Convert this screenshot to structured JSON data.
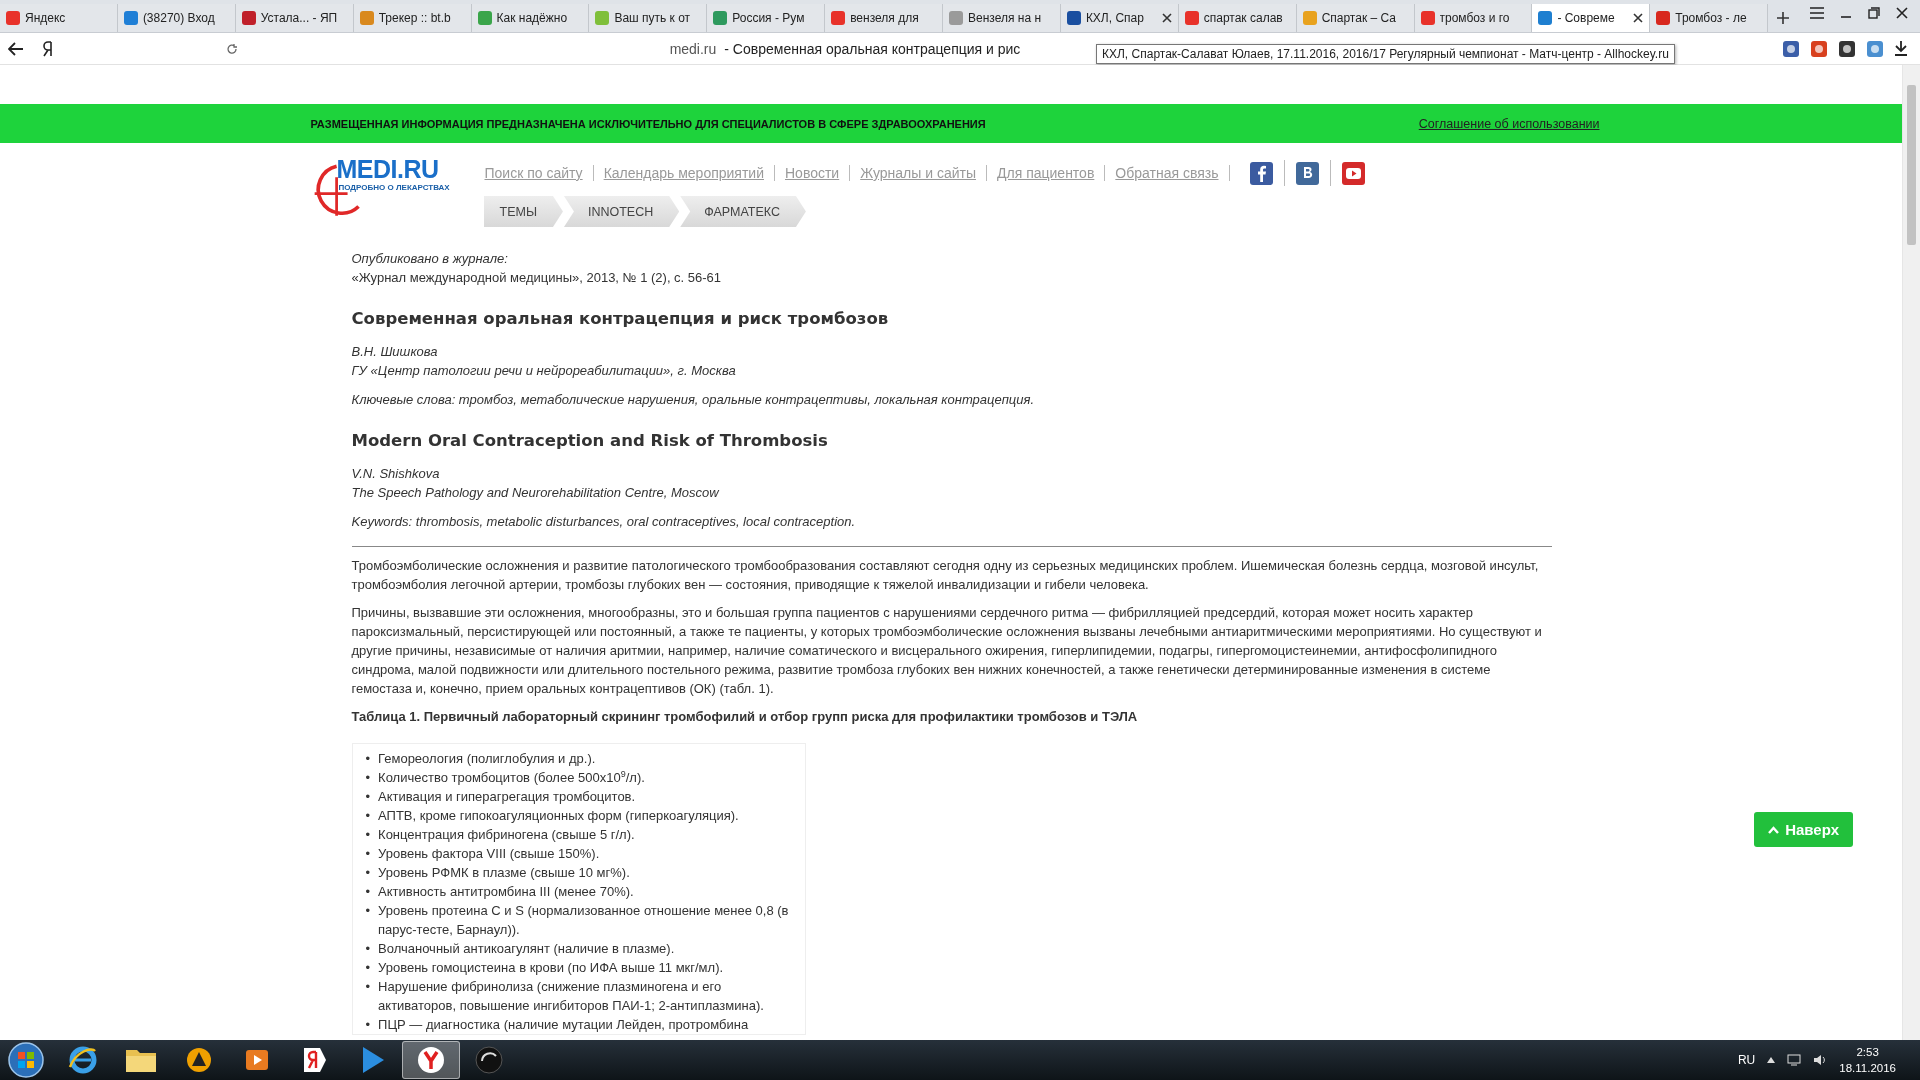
{
  "browser": {
    "tabs": [
      {
        "title": "Яндекс",
        "color": "#e8322a",
        "selected": false,
        "closable": false
      },
      {
        "title": "(38270) Вход",
        "color": "#1f7fd6",
        "selected": false,
        "closable": false
      },
      {
        "title": "Устала... - ЯП",
        "color": "#c0202a",
        "selected": false,
        "closable": false
      },
      {
        "title": "Трекер :: bt.b",
        "color": "#d9891e",
        "selected": false,
        "closable": false
      },
      {
        "title": "Как надёжно",
        "color": "#3aa54a",
        "selected": false,
        "closable": false
      },
      {
        "title": "Ваш путь к от",
        "color": "#7fbf3a",
        "selected": false,
        "closable": false
      },
      {
        "title": "Россия - Рум",
        "color": "#2e9a5e",
        "selected": false,
        "closable": false
      },
      {
        "title": "вензеля для",
        "color": "#e8322a",
        "selected": false,
        "closable": false
      },
      {
        "title": "Вензеля на н",
        "color": "#9a9a9a",
        "selected": false,
        "closable": false
      },
      {
        "title": "КХЛ, Спар",
        "color": "#1a4fa0",
        "selected": false,
        "closable": true
      },
      {
        "title": "спартак салав",
        "color": "#e8322a",
        "selected": false,
        "closable": false
      },
      {
        "title": "Спартак – Са",
        "color": "#e8a21e",
        "selected": false,
        "closable": false
      },
      {
        "title": "тромбоз и го",
        "color": "#e8322a",
        "selected": false,
        "closable": false
      },
      {
        "title": "- Совреме",
        "color": "#1e7fd0",
        "selected": true,
        "closable": true
      },
      {
        "title": "Тромбоз - ле",
        "color": "#d8281e",
        "selected": false,
        "closable": false
      }
    ],
    "address": {
      "domain": "medi.ru",
      "title": "- Современная оральная контрацепция и рис"
    },
    "tooltip": "КХЛ, Спартак-Салават Юлаев, 17.11.2016, 2016/17 Регулярный чемпионат - Матч-центр - Allhockey.ru"
  },
  "site": {
    "notice": "РАЗМЕЩЕННАЯ ИНФОРМАЦИЯ ПРЕДНАЗНАЧЕНА ИСКЛЮЧИТЕЛЬНО ДЛЯ СПЕЦИАЛИСТОВ В СФЕРЕ ЗДРАВООХРАНЕНИЯ",
    "agreement_link": "Соглашение об использовании",
    "logo": {
      "name": "MEDI.RU",
      "tagline": "ПОДРОБНО О ЛЕКАРСТВАХ"
    },
    "nav": [
      "Поиск по сайту",
      "Календарь мероприятий",
      "Новости",
      "Журналы и сайты",
      "Для пациентов",
      "Обратная связь"
    ],
    "social": [
      {
        "kind": "facebook"
      },
      {
        "kind": "vk"
      },
      {
        "kind": "youtube"
      }
    ],
    "breadcrumbs": [
      "ТЕМЫ",
      "INNOTECH",
      "ФАРМАТЕКС"
    ]
  },
  "article": {
    "published_label": "Опубликовано в журнале:",
    "published_source": "«Журнал международной медицины», 2013, № 1 (2), с. 56-61",
    "title_ru": "Современная оральная контрацепция и риск тромбозов",
    "author_ru": "В.Н. Шишкова",
    "org_ru": "ГУ «Центр патологии речи и нейрореабилитации», г. Москва",
    "keywords_ru": "Ключевые слова: тромбоз, метаболические нарушения, оральные контрацептивы, локальная контрацепция.",
    "title_en": "Modern Oral Contraception and Risk of Thrombosis",
    "author_en": "V.N. Shishkova",
    "org_en": "The Speech Pathology and Neurorehabilitation Centre, Moscow",
    "keywords_en": "Keywords: thrombosis, metabolic disturbances, oral contraceptives, local contraception.",
    "paragraphs": [
      "Тромбоэмболические осложнения и развитие патологического тромбообразования составляют сегодня одну из серьезных медицинских проблем. Ишемическая болезнь сердца, мозговой инсульт, тромбоэмболия легочной артерии, тромбозы глубоких вен — состояния, приводящие к тяжелой инвалидизации и гибели человека.",
      "Причины, вызвавшие эти осложнения, многообразны, это и большая группа пациентов с нарушениями сердечного ритма — фибрилляцией предсердий, которая может носить характер пароксизмальный, персистирующей или постоянный, а также те пациенты, у которых тромбоэмболические осложнения вызваны лечебными антиаритмическими мероприятиями. Но существуют и другие причины, независимые от наличия аритмии, например, наличие соматического и висцерального ожирения, гиперлипидемии, подагры, гипергомоцистеинемии, антифосфолипидного синдрома, малой подвижности или длительного постельного режима, развитие тромбоза глубоких вен нижних конечностей, а также генетически детерминированные изменения в системе гемостаза и, конечно, прием оральных контрацептивов (ОК) (табл. 1)."
    ],
    "table_caption": "Таблица 1. Первичный лабораторный скрининг тромбофилий и отбор групп риска для профилактики тромбозов и ТЭЛА",
    "table_bullet": "•",
    "table_items": [
      "Гемореология (полиглобулия и др.).",
      "Количество тромбоцитов (более 500x10$^{9}$/л).",
      "Активация и гиперагрегация тромбоцитов.",
      "АПТВ, кроме гипокоагуляционных форм (гиперкоагуляция).",
      "Концентрация фибриногена (свыше 5 г/л).",
      "Уровень фактора VIII (свыше 150%).",
      "Уровень РФМК в плазме (свыше 10 мг%).",
      "Активность антитромбина III (менее 70%).",
      "Уровень протеина С и S (нормализованное отношение менее 0,8 (в парус-тесте, Барнаул)).",
      "Волчаночный антикоагулянт (наличие в плазме).",
      "Уровень гомоцистеина в крови (по ИФА выше 11 мкг/мл).",
      "Нарушение фибринолиза (снижение плазминогена и его активаторов, повышение ингибиторов ПАИ-1; 2-антиплазмина).",
      "ПЦР — диагностика (наличие мутации Лейден, протромбина"
    ]
  },
  "back_to_top": {
    "label": "Наверх"
  },
  "taskbar": {
    "apps": [
      {
        "kind": "ie",
        "selected": false
      },
      {
        "kind": "folder",
        "selected": false
      },
      {
        "kind": "triangle",
        "selected": false
      },
      {
        "kind": "player",
        "selected": false
      },
      {
        "kind": "yandex",
        "selected": false
      },
      {
        "kind": "play",
        "selected": false
      },
      {
        "kind": "ybrowser",
        "selected": true
      },
      {
        "kind": "dark",
        "selected": false
      }
    ],
    "language": "RU",
    "time": "2:53",
    "date": "18.11.2016"
  }
}
